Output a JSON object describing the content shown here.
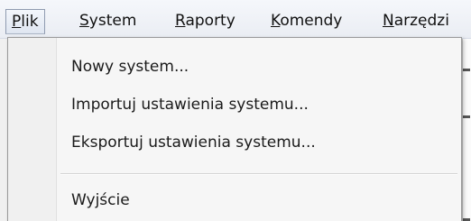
{
  "menubar": {
    "items": [
      {
        "mnemonic": "P",
        "rest": "lik"
      },
      {
        "mnemonic": "S",
        "rest": "ystem"
      },
      {
        "mnemonic": "R",
        "rest": "aporty"
      },
      {
        "mnemonic": "K",
        "rest": "omendy"
      },
      {
        "mnemonic": "N",
        "rest": "arzędzi"
      }
    ]
  },
  "file_menu": {
    "items": [
      {
        "label": "Nowy system..."
      },
      {
        "label": "Importuj ustawienia systemu..."
      },
      {
        "label": "Eksportuj ustawienia systemu..."
      },
      {
        "label": "Wyjście"
      }
    ]
  }
}
